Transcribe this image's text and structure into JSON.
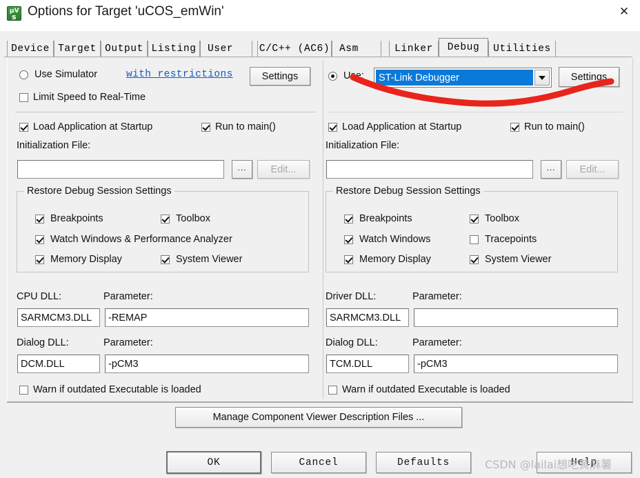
{
  "window": {
    "title": "Options for Target 'uCOS_emWin'",
    "icon": "uvision-icon",
    "close_icon": "close-icon",
    "close_glyph": "✕"
  },
  "tabs": [
    {
      "label": "Device",
      "active": false
    },
    {
      "label": "Target",
      "active": false
    },
    {
      "label": "Output",
      "active": false
    },
    {
      "label": "Listing",
      "active": false
    },
    {
      "label": "User",
      "active": false
    },
    {
      "label": "C/C++ (AC6)",
      "active": false
    },
    {
      "label": "Asm",
      "active": false
    },
    {
      "label": "Linker",
      "active": false
    },
    {
      "label": "Debug",
      "active": true
    },
    {
      "label": "Utilities",
      "active": false
    }
  ],
  "left_panel": {
    "use_simulator_label": "Use Simulator",
    "use_simulator_checked": false,
    "restrictions_link": "with restrictions",
    "settings_button": "Settings",
    "limit_speed_label": "Limit Speed to Real-Time",
    "limit_speed_checked": false,
    "load_app_label": "Load Application at Startup",
    "load_app_checked": true,
    "run_to_main_label": "Run to main()",
    "run_to_main_checked": true,
    "init_file_label": "Initialization File:",
    "init_file_value": "",
    "browse_button": "...",
    "edit_button": "Edit...",
    "restore_group_title": "Restore Debug Session Settings",
    "restore_items": [
      {
        "label": "Breakpoints",
        "checked": true
      },
      {
        "label": "Toolbox",
        "checked": true
      },
      {
        "label": "Watch Windows & Performance Analyzer",
        "checked": true
      },
      {
        "label": "Memory Display",
        "checked": true
      },
      {
        "label": "System Viewer",
        "checked": true
      }
    ],
    "cpu_dll_label": "CPU DLL:",
    "cpu_dll_value": "SARMCM3.DLL",
    "cpu_param_label": "Parameter:",
    "cpu_param_value": "-REMAP",
    "dialog_dll_label": "Dialog DLL:",
    "dialog_dll_value": "DCM.DLL",
    "dialog_param_label": "Parameter:",
    "dialog_param_value": "-pCM3",
    "warn_outdated_label": "Warn if outdated Executable is loaded",
    "warn_outdated_checked": false
  },
  "right_panel": {
    "use_label": "Use:",
    "use_checked": true,
    "debugger_selected": "ST-Link Debugger",
    "settings_button": "Settings",
    "load_app_label": "Load Application at Startup",
    "load_app_checked": true,
    "run_to_main_label": "Run to main()",
    "run_to_main_checked": true,
    "init_file_label": "Initialization File:",
    "init_file_value": "",
    "browse_button": "...",
    "edit_button": "Edit...",
    "restore_group_title": "Restore Debug Session Settings",
    "restore_items": [
      {
        "label": "Breakpoints",
        "checked": true
      },
      {
        "label": "Toolbox",
        "checked": true
      },
      {
        "label": "Watch Windows",
        "checked": true
      },
      {
        "label": "Tracepoints",
        "checked": false
      },
      {
        "label": "Memory Display",
        "checked": true
      },
      {
        "label": "System Viewer",
        "checked": true
      }
    ],
    "driver_dll_label": "Driver DLL:",
    "driver_dll_value": "SARMCM3.DLL",
    "driver_param_label": "Parameter:",
    "driver_param_value": "",
    "dialog_dll_label": "Dialog DLL:",
    "dialog_dll_value": "TCM.DLL",
    "dialog_param_label": "Parameter:",
    "dialog_param_value": "-pCM3",
    "warn_outdated_label": "Warn if outdated Executable is loaded",
    "warn_outdated_checked": false
  },
  "manage_button": "Manage Component Viewer Description Files ...",
  "footer": {
    "ok": "OK",
    "cancel": "Cancel",
    "defaults": "Defaults",
    "help": "Help"
  },
  "watermark": "CSDN @lailai想吃黄麻薯",
  "annotation": {
    "color": "#e8241c",
    "shape": "hand-drawn-underline-curve"
  },
  "colors": {
    "dialog_bg": "#f0f0f0",
    "titlebar_bg": "#ffffff",
    "accent_select": "#0a7ada",
    "link": "#1358c9",
    "annotation_red": "#e8241c"
  }
}
